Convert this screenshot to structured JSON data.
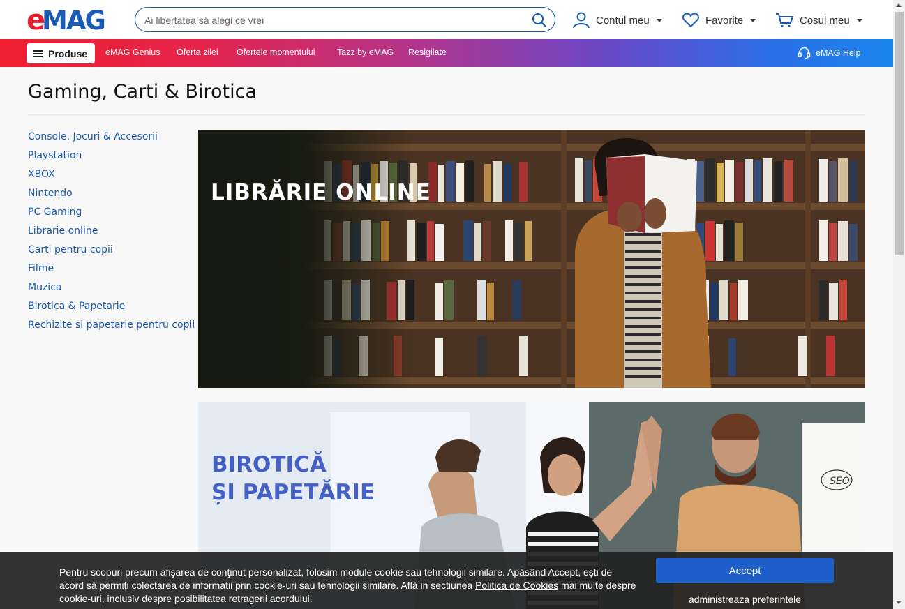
{
  "header": {
    "logo_text": "eMAG",
    "search_placeholder": "Ai libertatea să alegi ce vrei",
    "account_label": "Contul meu",
    "favorites_label": "Favorite",
    "cart_label": "Cosul meu"
  },
  "navbar": {
    "products_label": "Produse",
    "links": [
      "eMAG Genius",
      "Oferta zilei",
      "Ofertele momentului",
      "Tazz by eMAG",
      "Resigilate"
    ],
    "help_label": "eMAG Help"
  },
  "page": {
    "title": "Gaming, Carti & Birotica"
  },
  "sidebar": {
    "items": [
      "Console, Jocuri & Accesorii",
      "Playstation",
      "XBOX",
      "Nintendo",
      "PC Gaming",
      "Librarie online",
      "Carti pentru copii",
      "Filme",
      "Muzica",
      "Birotica & Papetarie",
      "Rechizite si papetarie pentru copii"
    ]
  },
  "banners": {
    "library_title": "LIBRĂRIE ONLINE",
    "office_title_line1": "BIROTICĂ",
    "office_title_line2": "ȘI PAPETĂRIE"
  },
  "cookie": {
    "text_before": "Pentru scopuri precum afişarea de conţinut personalizat, folosim module cookie sau tehnologii similare. Apăsând Accept, ești de acord să permiți colectarea de informații prin cookie-uri sau tehnologii similare. Află in sectiunea ",
    "policy_link": "Politica de Cookies",
    "text_after": " mai multe despre cookie-uri, inclusiv despre posibilitatea retragerii acordului.",
    "accept_label": "Accept",
    "preferences_label": "administreaza preferintele"
  },
  "colors": {
    "brand_blue": "#1a5bb5",
    "brand_red": "#ee1f2f",
    "link_blue": "#1b5bb0",
    "accept_blue": "#1f5fc9"
  }
}
